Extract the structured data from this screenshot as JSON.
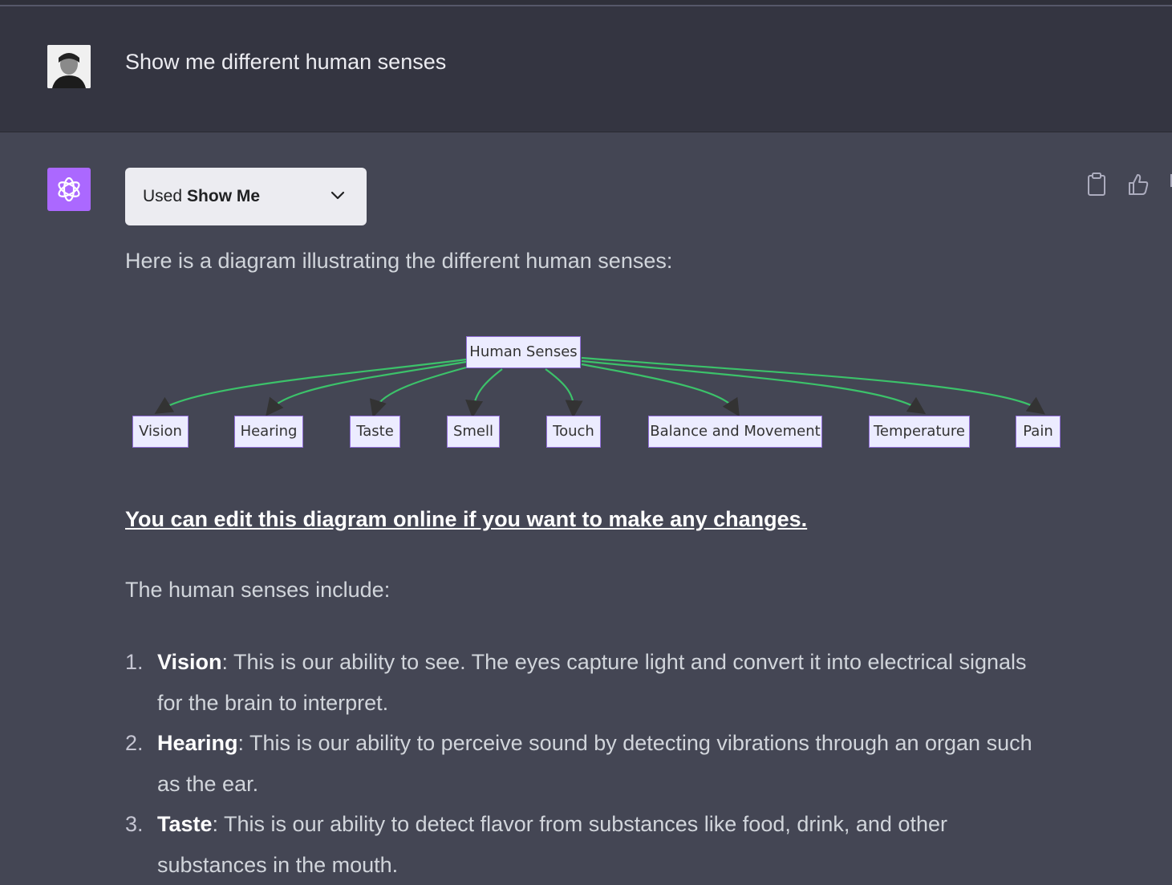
{
  "user": {
    "message": "Show me different human senses",
    "avatar_icon": "user-avatar-photo"
  },
  "assistant": {
    "avatar_icon": "openai-logo-icon",
    "plugin": {
      "prefix": "Used",
      "name": "Show Me",
      "icon": "chevron-down-icon"
    },
    "action_icons": [
      "clipboard-icon",
      "thumbs-up-icon",
      "thumbs-down-icon"
    ],
    "intro": "Here is a diagram illustrating the different human senses:",
    "diagram": {
      "root": "Human Senses",
      "children": [
        "Vision",
        "Hearing",
        "Taste",
        "Smell",
        "Touch",
        "Balance and Movement",
        "Temperature",
        "Pain"
      ],
      "edge_color": "#3cc26a",
      "node_fill": "#ececff",
      "node_border": "#9370db"
    },
    "edit_link": "You can edit this diagram online if you want to make any changes.",
    "list_intro": "The human senses include:",
    "senses": [
      {
        "num": "1.",
        "name": "Vision",
        "desc": ": This is our ability to see. The eyes capture light and convert it into electrical signals for the brain to interpret."
      },
      {
        "num": "2.",
        "name": "Hearing",
        "desc": ": This is our ability to perceive sound by detecting vibrations through an organ such as the ear."
      },
      {
        "num": "3.",
        "name": "Taste",
        "desc": ": This is our ability to detect flavor from substances like food, drink, and other substances in the mouth."
      }
    ]
  },
  "colors": {
    "user_bg": "#343541",
    "assistant_bg": "#444654",
    "bot_avatar": "#ab68ff"
  }
}
